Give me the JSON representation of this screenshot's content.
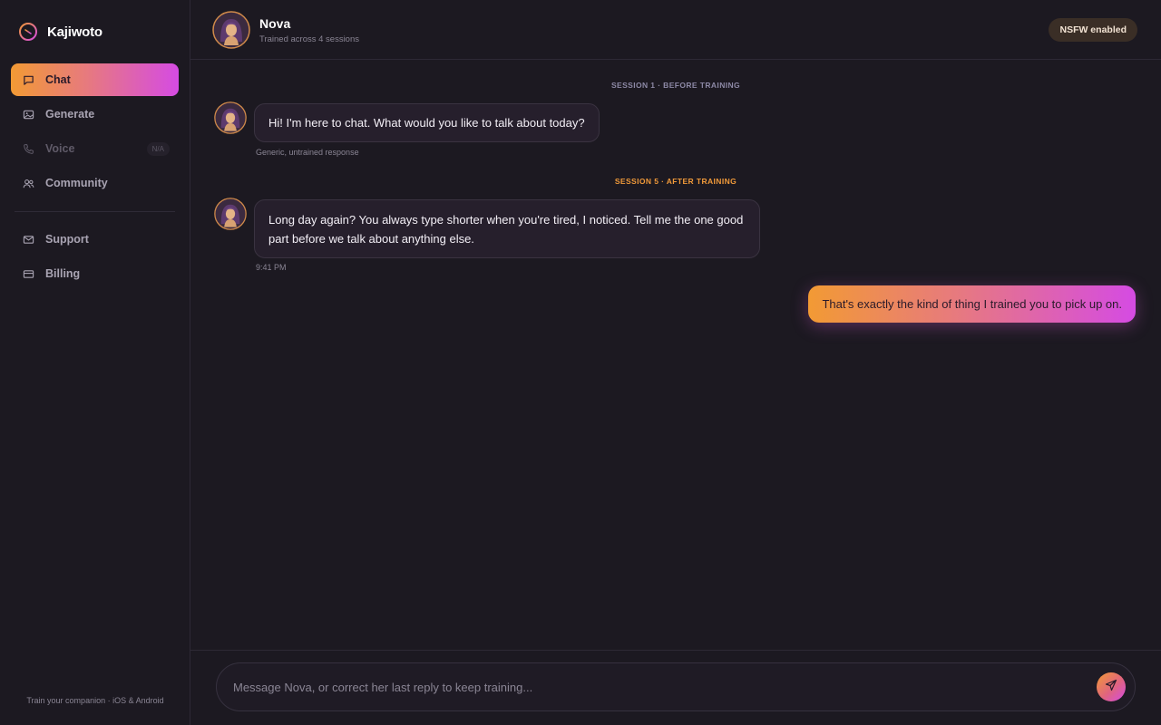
{
  "brand": {
    "name": "Kajiwoto"
  },
  "sidebar": {
    "items": [
      {
        "label": "Chat",
        "icon": "chat-icon"
      },
      {
        "label": "Generate",
        "icon": "image-icon"
      },
      {
        "label": "Voice",
        "icon": "phone-icon",
        "badge": "N/A"
      },
      {
        "label": "Community",
        "icon": "users-icon"
      },
      {
        "label": "Support",
        "icon": "mail-icon"
      },
      {
        "label": "Billing",
        "icon": "card-icon"
      }
    ],
    "footer": "Train your companion · iOS & Android"
  },
  "header": {
    "name": "Nova",
    "subtitle": "Trained across 4 sessions",
    "badge": "NSFW enabled"
  },
  "chat": {
    "session_before": "SESSION 1 · BEFORE TRAINING",
    "message_before": "Hi! I'm here to chat. What would you like to talk about today?",
    "meta_before": "Generic, untrained response",
    "session_after": "SESSION 5 · AFTER TRAINING",
    "message_after": "Long day again? You always type shorter when you're tired, I noticed. Tell me the one good part before we talk about anything else.",
    "meta_after": "9:41 PM",
    "user_message": "That's exactly the kind of thing I trained you to pick up on."
  },
  "composer": {
    "placeholder": "Message Nova, or correct her last reply to keep training..."
  },
  "colors": {
    "accent_start": "#f29a34",
    "accent_end": "#d54be3",
    "background": "#1c1921",
    "session_after": "#f19a3a"
  }
}
